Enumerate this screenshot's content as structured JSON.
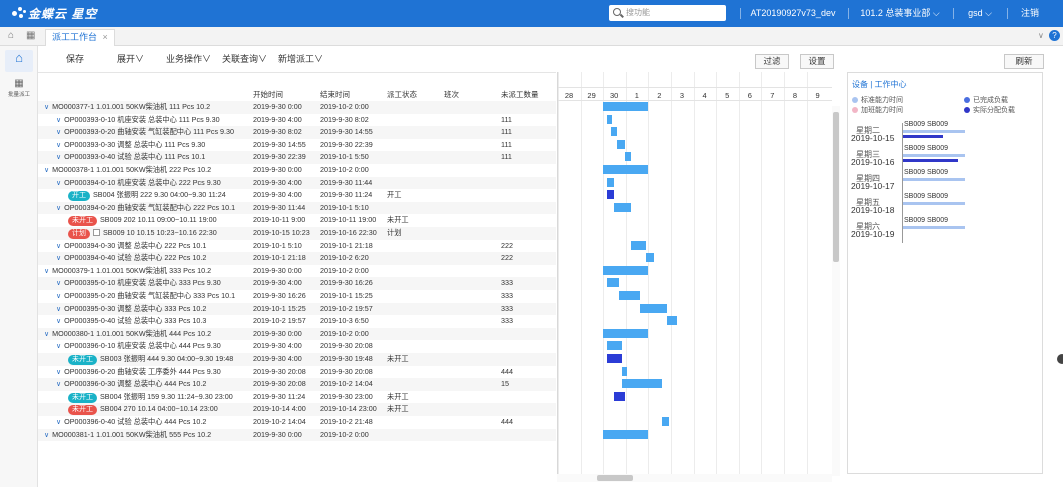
{
  "app": {
    "brand": "金蝶云 星空",
    "search_placeholder": "搜功能",
    "account": "AT20190927v73_dev",
    "org": "101.2 总装事业部",
    "user": "gsd",
    "logout": "注销"
  },
  "tabs": {
    "active": "派工工作台",
    "close": "×"
  },
  "sidebar": {
    "item1": "",
    "item2": "批量派工"
  },
  "toolbar": {
    "save": "保存",
    "expand": "展开",
    "business": "业务操作",
    "related": "关联查询",
    "add": "新增派工",
    "filter": "过滤",
    "settings": "设置",
    "refresh": "刷新"
  },
  "columns": {
    "start": "开始时间",
    "end": "结束时间",
    "status": "派工状态",
    "shift": "班次",
    "qty": "未派工数量"
  },
  "days": [
    "28",
    "29",
    "30",
    "1",
    "2",
    "3",
    "4",
    "5",
    "6",
    "7",
    "8",
    "9"
  ],
  "rows": [
    {
      "kind": "mo",
      "text": "MO000377-1 1.01.001 50KW柴油机 111 Pcs 10.2",
      "start": "2019-9-30 0:00",
      "end": "2019-10-2 0:00",
      "status": "",
      "qty": ""
    },
    {
      "kind": "op",
      "text": "OP000393-0-10 机座安装 总装中心 111 Pcs 9.30",
      "start": "2019-9-30 4:00",
      "end": "2019-9-30 8:02",
      "status": "",
      "qty": "111"
    },
    {
      "kind": "op",
      "text": "OP000393-0-20 曲轴安装 气缸装配中心 111 Pcs 9.30",
      "start": "2019-9-30 8:02",
      "end": "2019-9-30 14:55",
      "status": "",
      "qty": "111"
    },
    {
      "kind": "op",
      "text": "OP000393-0-30 调整 总装中心 111 Pcs 9.30",
      "start": "2019-9-30 14:55",
      "end": "2019-9-30 22:39",
      "status": "",
      "qty": "111"
    },
    {
      "kind": "op",
      "text": "OP000393-0-40 试验 总装中心 111 Pcs 10.1",
      "start": "2019-9-30 22:39",
      "end": "2019-10-1 5:50",
      "status": "",
      "qty": "111"
    },
    {
      "kind": "mo",
      "text": "MO000378-1 1.01.001 50KW柴油机 222 Pcs 10.2",
      "start": "2019-9-30 0:00",
      "end": "2019-10-2 0:00",
      "status": "",
      "qty": ""
    },
    {
      "kind": "op",
      "text": "OP000394-0-10 机座安装 总装中心 222 Pcs 9.30",
      "start": "2019-9-30 4:00",
      "end": "2019-9-30 11:44",
      "status": "",
      "qty": ""
    },
    {
      "kind": "dispatch",
      "badge": "开工",
      "badgeColor": "#1ab2c7",
      "text": "SB004 张振明 222 9.30 04:00~9.30 11:24",
      "start": "2019-9-30 4:00",
      "end": "2019-9-30 11:24",
      "status": "开工",
      "qty": ""
    },
    {
      "kind": "op",
      "text": "OP000394-0-20 曲轴安装 气缸装配中心 222 Pcs 10.1",
      "start": "2019-9-30 11:44",
      "end": "2019-10-1 5:10",
      "status": "",
      "qty": ""
    },
    {
      "kind": "dispatch",
      "badge": "未开工",
      "badgeColor": "#e9534b",
      "text": "SB009 202 10.11 09:00~10.11 19:00",
      "start": "2019-10-11 9:00",
      "end": "2019-10-11 19:00",
      "status": "未开工",
      "qty": ""
    },
    {
      "kind": "dispatch",
      "badge": "计划",
      "badgeColor": "#e9534b",
      "check": true,
      "text": "SB009 10 10.15 10:23~10.16 22:30",
      "start": "2019-10-15 10:23",
      "end": "2019-10-16 22:30",
      "status": "计划",
      "qty": ""
    },
    {
      "kind": "op",
      "text": "OP000394-0-30 调整 总装中心 222 Pcs 10.1",
      "start": "2019-10-1 5:10",
      "end": "2019-10-1 21:18",
      "status": "",
      "qty": "222"
    },
    {
      "kind": "op",
      "text": "OP000394-0-40 试验 总装中心 222 Pcs 10.2",
      "start": "2019-10-1 21:18",
      "end": "2019-10-2 6:20",
      "status": "",
      "qty": "222"
    },
    {
      "kind": "mo",
      "text": "MO000379-1 1.01.001 50KW柴油机 333 Pcs 10.2",
      "start": "2019-9-30 0:00",
      "end": "2019-10-2 0:00",
      "status": "",
      "qty": ""
    },
    {
      "kind": "op",
      "text": "OP000395-0-10 机座安装 总装中心 333 Pcs 9.30",
      "start": "2019-9-30 4:00",
      "end": "2019-9-30 16:26",
      "status": "",
      "qty": "333"
    },
    {
      "kind": "op",
      "text": "OP000395-0-20 曲轴安装 气缸装配中心 333 Pcs 10.1",
      "start": "2019-9-30 16:26",
      "end": "2019-10-1 15:25",
      "status": "",
      "qty": "333"
    },
    {
      "kind": "op",
      "text": "OP000395-0-30 调整 总装中心 333 Pcs 10.2",
      "start": "2019-10-1 15:25",
      "end": "2019-10-2 19:57",
      "status": "",
      "qty": "333"
    },
    {
      "kind": "op",
      "text": "OP000395-0-40 试验 总装中心 333 Pcs 10.3",
      "start": "2019-10-2 19:57",
      "end": "2019-10-3 6:50",
      "status": "",
      "qty": "333"
    },
    {
      "kind": "mo",
      "text": "MO000380-1 1.01.001 50KW柴油机 444 Pcs 10.2",
      "start": "2019-9-30 0:00",
      "end": "2019-10-2 0:00",
      "status": "",
      "qty": ""
    },
    {
      "kind": "op",
      "text": "OP000396-0-10 机座安装 总装中心 444 Pcs 9.30",
      "start": "2019-9-30 4:00",
      "end": "2019-9-30 20:08",
      "status": "",
      "qty": ""
    },
    {
      "kind": "dispatch",
      "badge": "未开工",
      "badgeColor": "#1ab2c7",
      "text": "SB003 张振明 444 9.30 04:00~9.30 19:48",
      "start": "2019-9-30 4:00",
      "end": "2019-9-30 19:48",
      "status": "未开工",
      "qty": ""
    },
    {
      "kind": "op",
      "text": "OP000396-0-20 曲轴安装 工序委外 444 Pcs 9.30",
      "start": "2019-9-30 20:08",
      "end": "2019-9-30 20:08",
      "status": "",
      "qty": "444"
    },
    {
      "kind": "op",
      "text": "OP000396-0-30 调整 总装中心 444 Pcs 10.2",
      "start": "2019-9-30 20:08",
      "end": "2019-10-2 14:04",
      "status": "",
      "qty": "15"
    },
    {
      "kind": "dispatch",
      "badge": "未开工",
      "badgeColor": "#1ab2c7",
      "text": "SB004 张振明 159 9.30 11:24~9.30 23:00",
      "start": "2019-9-30 11:24",
      "end": "2019-9-30 23:00",
      "status": "未开工",
      "qty": ""
    },
    {
      "kind": "dispatch",
      "badge": "未开工",
      "badgeColor": "#e9534b",
      "text": "SB004 270 10.14 04:00~10.14 23:00",
      "start": "2019-10-14 4:00",
      "end": "2019-10-14 23:00",
      "status": "未开工",
      "qty": ""
    },
    {
      "kind": "op",
      "text": "OP000396-0-40 试验 总装中心 444 Pcs 10.2",
      "start": "2019-10-2 14:04",
      "end": "2019-10-2 21:48",
      "status": "",
      "qty": "444"
    },
    {
      "kind": "mo",
      "text": "MO000381-1 1.01.001 50KW柴油机 555 Pcs 10.2",
      "start": "2019-9-30 0:00",
      "end": "2019-10-2 0:00",
      "status": "",
      "qty": ""
    }
  ],
  "right_panel": {
    "breadcrumb": "设备 | 工作中心",
    "legend": [
      {
        "label": "标准能力时间",
        "color": "#a9c4f0"
      },
      {
        "label": "已完成负载",
        "color": "#4a6ee0"
      },
      {
        "label": "加班能力时间",
        "color": "#f2b6c6"
      },
      {
        "label": "实际分配负载",
        "color": "#3037c8"
      }
    ],
    "days": [
      {
        "weekday": "星期二",
        "date": "2019-10-15",
        "devices": "SB009 SB009"
      },
      {
        "weekday": "星期三",
        "date": "2019-10-16",
        "devices": "SB009 SB009"
      },
      {
        "weekday": "星期四",
        "date": "2019-10-17",
        "devices": "SB009 SB009"
      },
      {
        "weekday": "星期五",
        "date": "2019-10-18",
        "devices": "SB009 SB009"
      },
      {
        "weekday": "星期六",
        "date": "2019-10-19",
        "devices": "SB009 SB009"
      }
    ]
  }
}
